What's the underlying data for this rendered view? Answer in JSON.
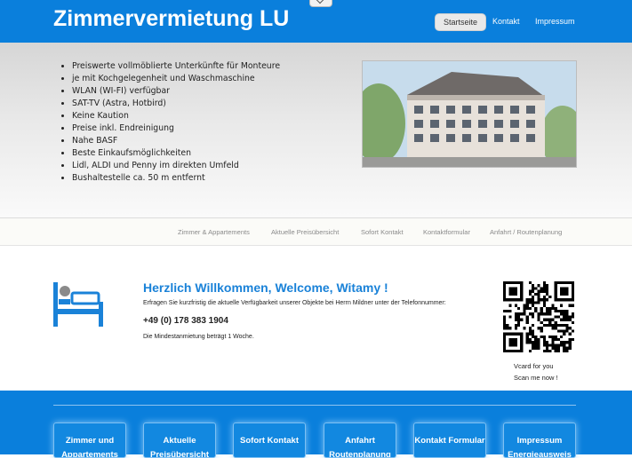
{
  "header": {
    "title": "Zimmervermietung LU",
    "nav": [
      "Startseite",
      "Kontakt",
      "Impressum"
    ],
    "active_nav": "Startseite"
  },
  "hero": {
    "features": [
      "Preiswerte vollmöblierte Unterkünfte für Monteure",
      "je mit Kochgelegenheit und Waschmaschine",
      "WLAN (WI-FI) verfügbar",
      "SAT-TV (Astra, Hotbird)",
      "Keine Kaution",
      "Preise inkl. Endreinigung",
      "Nahe BASF",
      "Beste Einkaufsmöglichkeiten",
      "Lidl, ALDI und Penny im direkten Umfeld",
      "Bushaltestelle ca. 50 m entfernt"
    ]
  },
  "subnav": [
    "Zimmer & Appartements",
    "Aktuelle Preisübersicht",
    "Sofort Kontakt",
    "Kontaktformular",
    "Anfahrt / Routenplanung"
  ],
  "welcome": {
    "title": "Herzlich Willkommen, Welcome, Witamy !",
    "text": "Erfragen Sie kurzfristig die aktuelle Verfügbarkeit unserer Objekte bei Herrn Mildner unter der Telefonnummer:",
    "phone": "+49 (0) 178 383 1904",
    "min_stay": "Die Mindestanmietung beträgt 1 Woche.",
    "vcard_line1": "Vcard for you",
    "vcard_line2": "Scan me now !"
  },
  "footer_buttons": [
    "Zimmer und Appartements",
    "Aktuelle Preisübersicht",
    "Sofort Kontakt",
    "Anfahrt Routenplanung",
    "Kontakt Formular",
    "Impressum Energieausweis"
  ],
  "colors": {
    "brand_blue": "#0a7fdc",
    "accent_blue": "#1a82d8"
  }
}
